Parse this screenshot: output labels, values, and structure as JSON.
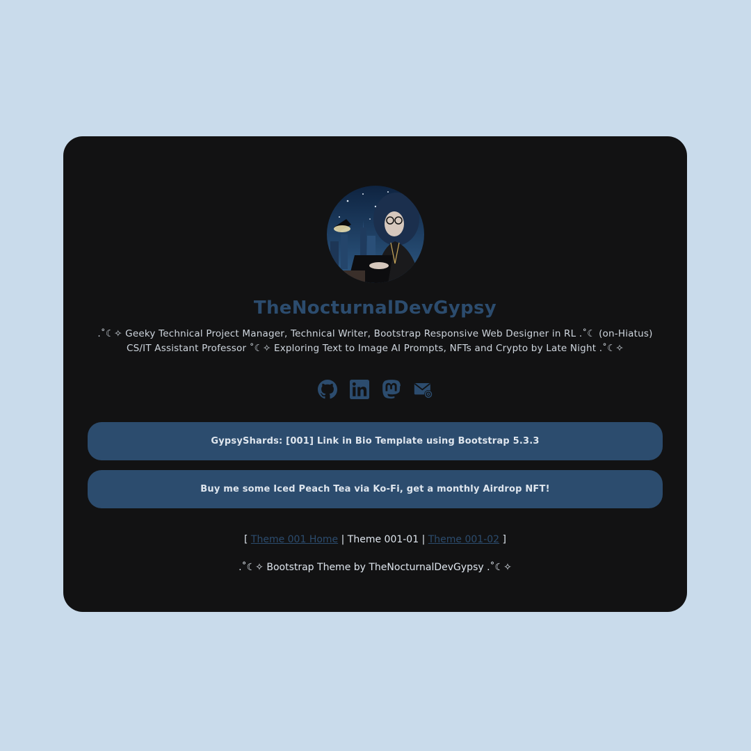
{
  "colors": {
    "page_background": "#c9dbeb",
    "card_background": "#121213",
    "accent": "#2c4c6e",
    "text": "#cfd6de"
  },
  "profile": {
    "name": "TheNocturnalDevGypsy",
    "bio": ".˚☾✧ Geeky Technical Project Manager, Technical Writer, Bootstrap Responsive Web Designer in RL .˚☾ (on-Hiatus) CS/IT Assistant Professor ˚☾✧ Exploring Text to Image AI Prompts, NFTs and Crypto by Late Night .˚☾✧"
  },
  "socials": [
    {
      "icon": "github-icon"
    },
    {
      "icon": "linkedin-icon"
    },
    {
      "icon": "mastodon-icon"
    },
    {
      "icon": "email-icon"
    }
  ],
  "buttons": {
    "template_link": "GypsyShards: [001] Link in Bio Template using Bootstrap 5.3.3",
    "kofi_link": "Buy me some Iced Peach Tea via Ko-Fi, get a monthly Airdrop NFT!"
  },
  "theme_nav": {
    "open_bracket": "[",
    "home_link": "Theme 001 Home",
    "separator": "|",
    "current": "Theme 001-01",
    "next_link": "Theme 001-02",
    "close_bracket": "]"
  },
  "footer": {
    "text": ".˚☾✧ Bootstrap Theme by TheNocturnalDevGypsy .˚☾✧"
  }
}
